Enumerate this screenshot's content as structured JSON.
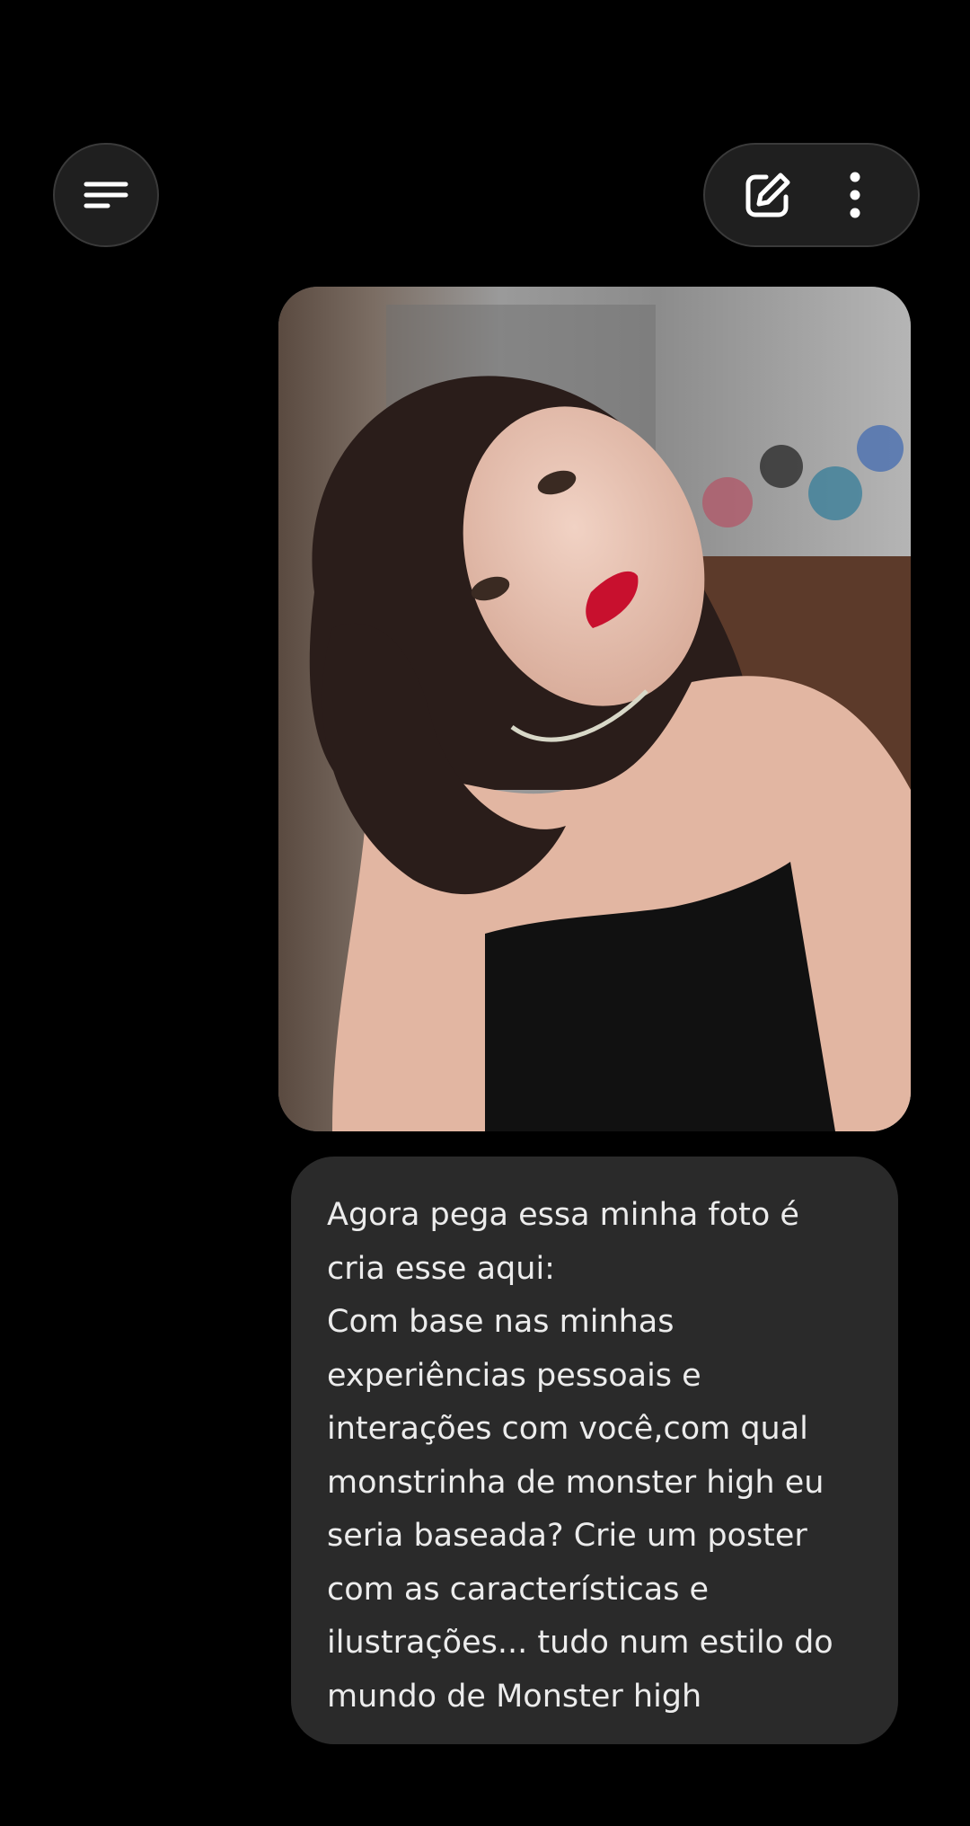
{
  "header": {
    "menu_icon": "menu-lines-icon",
    "new_chat_icon": "pencil-square-icon",
    "more_icon": "more-vertical-icon"
  },
  "message": {
    "attachment": {
      "type": "photo",
      "icon": "photo-portrait"
    },
    "text": "Agora pega essa minha foto é\ncria esse aqui:\nCom base nas minhas\nexperiências pessoais e\ninterações com você,com qual\nmonstrinha de monster high eu\nseria baseada? Crie um poster\ncom as características e\nilustrações... tudo num estilo do\nmundo de Monster high"
  },
  "colors": {
    "background": "#000000",
    "bubble": "#2a2a2a",
    "button": "#1f1f1f",
    "text": "#ececec"
  }
}
